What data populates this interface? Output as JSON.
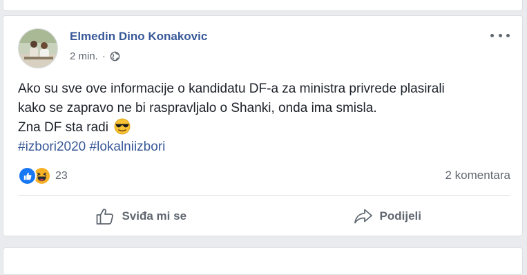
{
  "post": {
    "author": "Elmedin Dino Konakovic",
    "time": "2 min.",
    "separator": "·",
    "privacy_icon": "globe-icon",
    "text_lines": [
      "Ako su sve ove informacije o kandidatu DF-a za ministra privrede plasirali",
      "kako se zapravo ne bi raspravljalo o Shanki, onda ima smisla.",
      "Zna DF sta radi"
    ],
    "emoji": "sunglasses-emoji",
    "hashtags": [
      "#izbori2020",
      "#lokalniizbori"
    ],
    "reactions": {
      "types": [
        "like",
        "haha"
      ],
      "count": "23"
    },
    "comments": "2 komentara",
    "actions": {
      "like_label": "Sviđa mi se",
      "share_label": "Podijeli"
    }
  },
  "colors": {
    "link": "#385898",
    "secondary_text": "#606770",
    "like_blue": "#1877f2",
    "haha_yellow": "#f7b125",
    "background": "#e9ebee"
  }
}
